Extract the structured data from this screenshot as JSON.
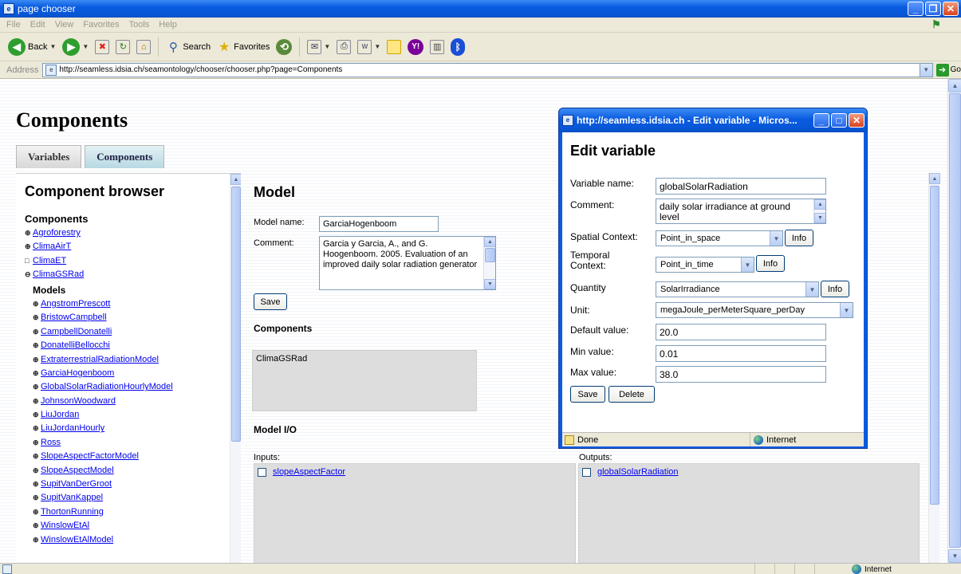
{
  "window": {
    "title": "page chooser"
  },
  "menubar": [
    "File",
    "Edit",
    "View",
    "Favorites",
    "Tools",
    "Help"
  ],
  "toolbar": {
    "back": "Back",
    "search": "Search",
    "favorites": "Favorites"
  },
  "address": {
    "label": "Address",
    "url": "http://seamless.idsia.ch/seamontology/chooser/chooser.php?page=Components",
    "go": "Go"
  },
  "page": {
    "title": "Components",
    "tabs": [
      "Variables",
      "Components"
    ]
  },
  "browser": {
    "heading": "Component browser",
    "components_label": "Components",
    "components": [
      {
        "exp": "⊕",
        "label": "Agroforestry"
      },
      {
        "exp": "⊕",
        "label": "ClimaAirT"
      },
      {
        "exp": "□",
        "label": "ClimaET"
      },
      {
        "exp": "⊖",
        "label": "ClimaGSRad"
      }
    ],
    "models_label": "Models",
    "models": [
      "AngstromPrescott",
      "BristowCampbell",
      "CampbellDonatelli",
      "DonatelliBellocchi",
      "ExtraterrestrialRadiationModel",
      "GarciaHogenboom",
      "GlobalSolarRadiationHourlyModel",
      "JohnsonWoodward",
      "LiuJordan",
      "LiuJordanHourly",
      "Ross",
      "SlopeAspectFactorModel",
      "SlopeAspectModel",
      "SupitVanDerGroot",
      "SupitVanKappel",
      "ThortonRunning",
      "WinslowEtAl",
      "WinslowEtAlModel"
    ]
  },
  "model": {
    "heading": "Model",
    "name_label": "Model name:",
    "name_value": "GarciaHogenboom",
    "comment_label": "Comment:",
    "comment_value": "Garcia y Garcia, A., and G. Hoogenboom. 2005. Evaluation of an improved daily solar radiation generator",
    "save": "Save",
    "components_heading": "Components",
    "components_value": "ClimaGSRad",
    "io_heading": "Model I/O",
    "inputs_label": "Inputs:",
    "inputs": [
      "slopeAspectFactor"
    ],
    "outputs_label": "Outputs:",
    "outputs": [
      "globalSolarRadiation"
    ]
  },
  "popup": {
    "title": "http://seamless.idsia.ch - Edit variable - Micros...",
    "heading": "Edit variable",
    "variable_name_label": "Variable name:",
    "variable_name": "globalSolarRadiation",
    "comment_label": "Comment:",
    "comment": "daily solar irradiance at ground level",
    "spatial_label": "Spatial Context:",
    "spatial": "Point_in_space",
    "temporal_label": "Temporal Context:",
    "temporal": "Point_in_time",
    "quantity_label": "Quantity",
    "quantity": "SolarIrradiance",
    "unit_label": "Unit:",
    "unit": "megaJoule_perMeterSquare_perDay",
    "default_label": "Default value:",
    "default": "20.0",
    "min_label": "Min value:",
    "min": "0.01",
    "max_label": "Max value:",
    "max": "38.0",
    "info": "Info",
    "save": "Save",
    "delete": "Delete",
    "status_done": "Done",
    "status_zone": "Internet"
  },
  "statusbar": {
    "zone": "Internet"
  },
  "colors": {
    "xp_blue": "#0a5be0",
    "link": "#0000ee",
    "chrome": "#ece9d8"
  }
}
